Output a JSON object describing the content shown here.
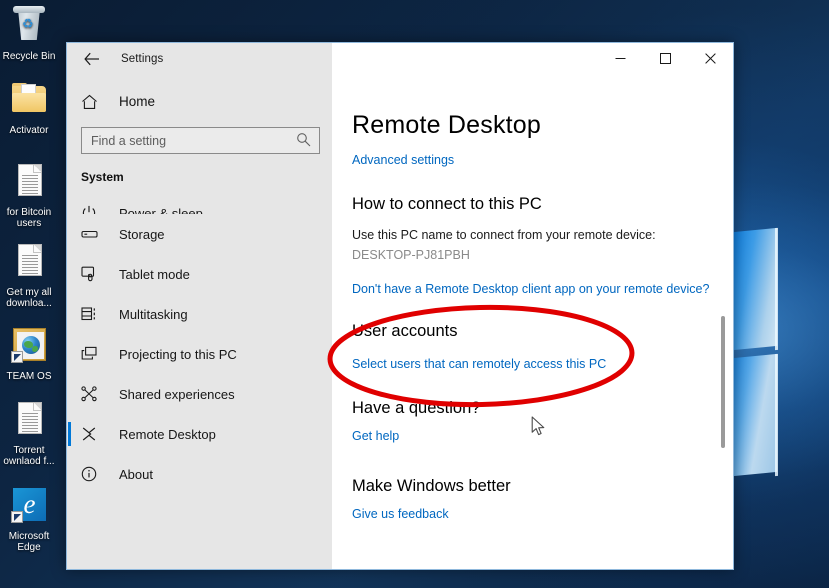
{
  "desktop": {
    "icons": [
      {
        "name": "recycle-bin",
        "label": "Recycle Bin",
        "type": "recycle"
      },
      {
        "name": "activator",
        "label": "Activator",
        "type": "folder"
      },
      {
        "name": "for-bitcoin-users",
        "label": "for Bitcoin users",
        "type": "document"
      },
      {
        "name": "get-my-all-download",
        "label": "Get my all downloa...",
        "type": "document"
      },
      {
        "name": "team-os",
        "label": "TEAM OS",
        "type": "globe-shortcut"
      },
      {
        "name": "torrent-download-file",
        "label": "Torrent ownlaod f...",
        "type": "document"
      },
      {
        "name": "microsoft-edge",
        "label": "Microsoft Edge",
        "type": "edge-shortcut"
      }
    ]
  },
  "window": {
    "title": "Settings",
    "back_tooltip": "Back",
    "controls": {
      "minimize": "–",
      "maximize": "□",
      "close": "✕"
    }
  },
  "sidebar": {
    "home_label": "Home",
    "search": {
      "placeholder": "Find a setting",
      "value": ""
    },
    "section_label": "System",
    "items": [
      {
        "label": "Power & sleep",
        "icon": "power-icon",
        "selected": false,
        "clipped": true
      },
      {
        "label": "Storage",
        "icon": "storage-icon",
        "selected": false,
        "clipped": false
      },
      {
        "label": "Tablet mode",
        "icon": "tablet-icon",
        "selected": false,
        "clipped": false
      },
      {
        "label": "Multitasking",
        "icon": "multitasking-icon",
        "selected": false,
        "clipped": false
      },
      {
        "label": "Projecting to this PC",
        "icon": "projecting-icon",
        "selected": false,
        "clipped": false
      },
      {
        "label": "Shared experiences",
        "icon": "shared-experiences-icon",
        "selected": false,
        "clipped": false
      },
      {
        "label": "Remote Desktop",
        "icon": "remote-desktop-icon",
        "selected": true,
        "clipped": false
      },
      {
        "label": "About",
        "icon": "info-icon",
        "selected": false,
        "clipped": false
      }
    ]
  },
  "main": {
    "page_title": "Remote Desktop",
    "advanced_settings_link": "Advanced settings",
    "how_to_connect": {
      "heading": "How to connect to this PC",
      "description": "Use this PC name to connect from your remote device:",
      "pc_name": "DESKTOP-PJ81PBH",
      "client_app_link": "Don't have a Remote Desktop client app on your remote device?"
    },
    "user_accounts": {
      "heading": "User accounts",
      "select_users_link": "Select users that can remotely access this PC"
    },
    "have_a_question": {
      "heading": "Have a question?",
      "get_help_link": "Get help"
    },
    "make_windows_better": {
      "heading": "Make Windows better",
      "feedback_link": "Give us feedback"
    }
  },
  "annotation": {
    "shape": "ellipse",
    "color": "#e00000",
    "stroke_width": 5,
    "target": "User accounts section"
  },
  "colors": {
    "accent": "#0078d7",
    "link": "#0067c0",
    "sidebar_bg": "#e6e6e6",
    "content_bg": "#ffffff",
    "annotation_red": "#e00000"
  }
}
